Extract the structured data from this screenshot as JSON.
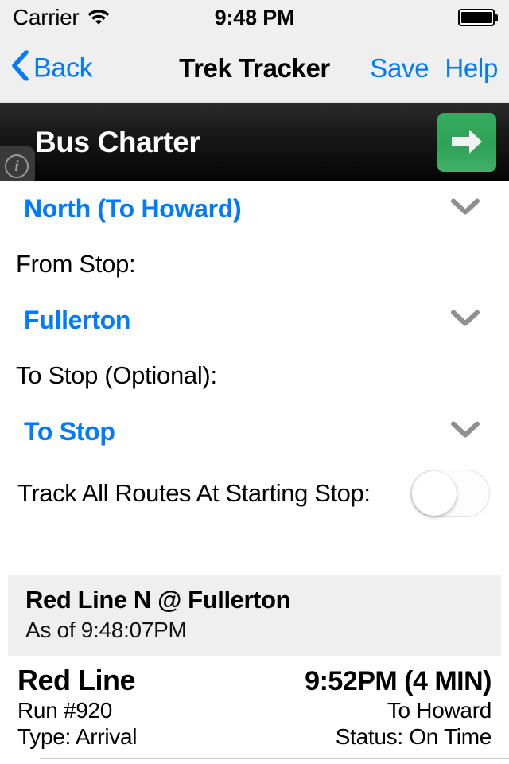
{
  "status_bar": {
    "carrier": "Carrier",
    "time": "9:48 PM",
    "wifi_icon": "wifi-icon",
    "battery_icon": "battery-full-icon"
  },
  "nav_bar": {
    "back_label": "Back",
    "back_icon": "chevron-left-icon",
    "title": "Trek Tracker",
    "save_label": "Save",
    "help_label": "Help"
  },
  "banner": {
    "title": "Bus Charter",
    "info_icon": "info-circle-icon",
    "info_glyph": "i",
    "go_icon": "arrow-right-icon",
    "go_color": "#32a85c",
    "background_color": "#0a0a0a"
  },
  "form": {
    "direction": {
      "value": "North (To Howard)",
      "chevron_icon": "chevron-down-icon"
    },
    "from_stop": {
      "label": "From Stop:",
      "value": "Fullerton",
      "chevron_icon": "chevron-down-icon"
    },
    "to_stop": {
      "label": "To Stop (Optional):",
      "value": "To Stop",
      "chevron_icon": "chevron-down-icon"
    },
    "track_all": {
      "label": "Track All Routes At Starting Stop:",
      "state": "off"
    },
    "accent_color": "#007aff"
  },
  "results": {
    "header": {
      "title": "Red Line N @ Fullerton",
      "subtitle": "As of 9:48:07PM"
    },
    "rows": [
      {
        "route": "Red Line",
        "arrival": "9:52PM (4 MIN)",
        "run": "Run #920",
        "destination": "To Howard",
        "type": "Type: Arrival",
        "status": "Status: On Time"
      }
    ]
  }
}
